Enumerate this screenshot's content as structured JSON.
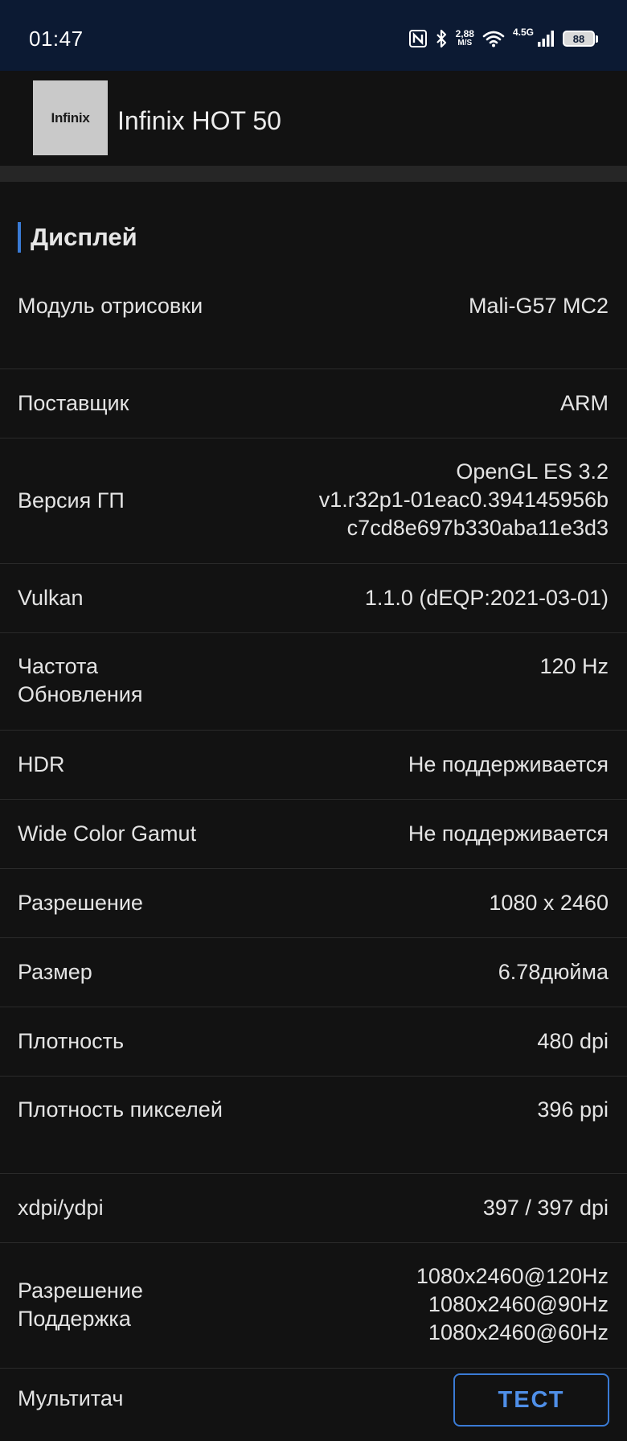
{
  "status_bar": {
    "time": "01:47",
    "net_speed_value": "2,88",
    "net_speed_unit": "M/S",
    "network_type": "4.5G",
    "battery": "88",
    "icons": [
      "nfc-icon",
      "bluetooth-icon",
      "wifi-icon",
      "signal-icon",
      "battery-icon"
    ]
  },
  "device": {
    "logo_text": "Infinix",
    "name": "Infinix HOT 50"
  },
  "section": {
    "title": "Дисплей",
    "accent_color": "#3a7bd5"
  },
  "rows": [
    {
      "label": "Модуль отрисовки",
      "value": "Mali-G57 MC2"
    },
    {
      "label": "Поставщик",
      "value": "ARM"
    },
    {
      "label": "Версия ГП",
      "value": "OpenGL ES 3.2\nv1.r32p1-01eac0.394145956b\nc7cd8e697b330aba11e3d3"
    },
    {
      "label": "Vulkan",
      "value": "1.1.0 (dEQP:2021-03-01)"
    },
    {
      "label": "Частота Обновления",
      "value": "120 Hz"
    },
    {
      "label": "HDR",
      "value": "Не поддерживается"
    },
    {
      "label": "Wide Color Gamut",
      "value": "Не поддерживается"
    },
    {
      "label": "Разрешение",
      "value": "1080 x 2460"
    },
    {
      "label": "Размер",
      "value": "6.78дюйма"
    },
    {
      "label": "Плотность",
      "value": "480 dpi"
    },
    {
      "label": "Плотность пикселей",
      "value": "396 ppi"
    },
    {
      "label": "xdpi/ydpi",
      "value": "397 / 397 dpi"
    },
    {
      "label": "Разрешение Поддержка",
      "value": "1080x2460@120Hz\n1080x2460@90Hz\n1080x2460@60Hz"
    },
    {
      "label": "Мультитач",
      "button": "ТЕСТ"
    }
  ]
}
